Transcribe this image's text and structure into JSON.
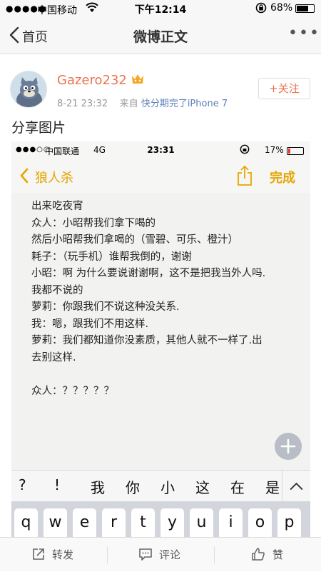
{
  "status_bar": {
    "carrier": "中国移动",
    "time": "下午12:14",
    "battery": "68%",
    "battery_level": 0.68
  },
  "nav": {
    "back_label": "首页",
    "title": "微博正文"
  },
  "post": {
    "username": "Gazero232",
    "timestamp": "8-21 23:32",
    "source_prefix": "来自",
    "source": "快分期完了iPhone 7",
    "follow_label": "+关注",
    "text": "分享图片"
  },
  "screenshot": {
    "status": {
      "carrier": "中国联通",
      "network": "4G",
      "time": "23:31",
      "battery": "17%",
      "battery_level": 0.17
    },
    "nav": {
      "back_label": "狼人杀",
      "done_label": "完成"
    },
    "note_lines": [
      "出来吃夜宵",
      "众人：小昭帮我们拿下喝的",
      "然后小昭帮我们拿喝的（雪碧、可乐、橙汁）",
      "耗子：（玩手机）谁帮我倒的，谢谢",
      "小昭：啊 为什么要说谢谢啊，这不是把我当外人吗.",
      "我都不说的",
      "萝莉：你跟我们不说这种没关系.",
      "我：嗯，跟我们不用这样.",
      "萝莉：我们都知道你没素质，其他人就不一样了.出",
      "去别这样.",
      "",
      "众人：？？？？？"
    ],
    "suggestions": [
      "?",
      "!",
      "我",
      "你",
      "小",
      "这",
      "在",
      "是"
    ],
    "keys": [
      "q",
      "w",
      "e",
      "r",
      "t",
      "y",
      "u",
      "i",
      "o",
      "p"
    ]
  },
  "toolbar": {
    "repost": "转发",
    "comment": "评论",
    "like": "赞"
  }
}
